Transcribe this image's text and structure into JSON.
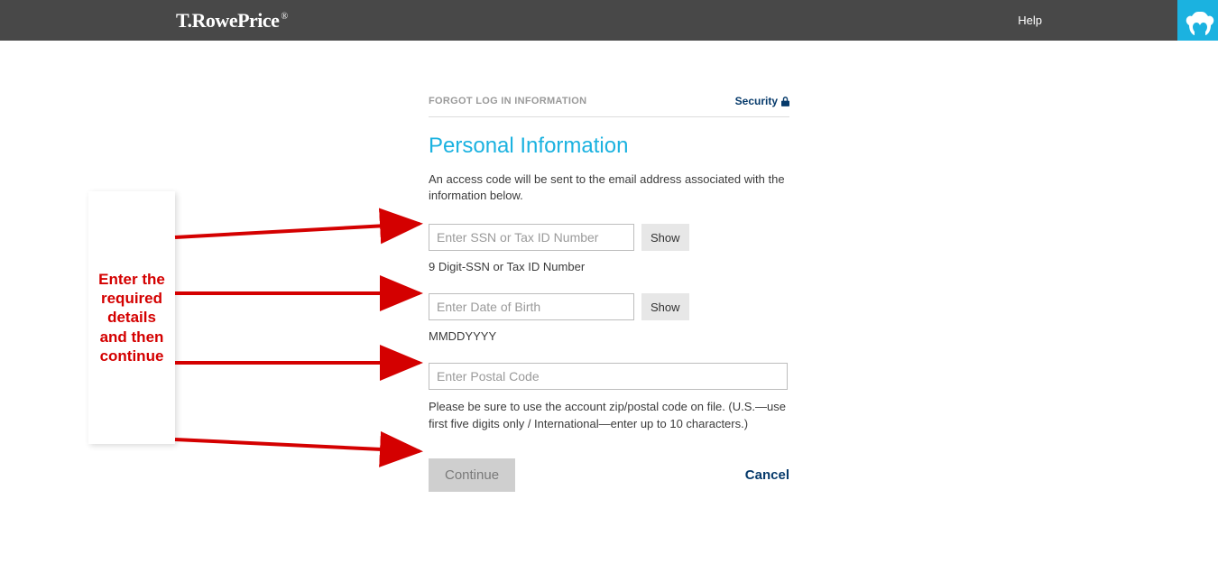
{
  "header": {
    "brand_text": "T.RowePrice",
    "brand_mark": "®",
    "help_label": "Help"
  },
  "page": {
    "forgot_label": "FORGOT LOG IN INFORMATION",
    "security_label": "Security",
    "title": "Personal Information",
    "description": "An access code will be sent to the email address associated with the information below."
  },
  "fields": {
    "ssn": {
      "placeholder": "Enter SSN or Tax ID Number",
      "show_label": "Show",
      "hint": "9 Digit-SSN or Tax ID Number"
    },
    "dob": {
      "placeholder": "Enter Date of Birth",
      "show_label": "Show",
      "hint": "MMDDYYYY"
    },
    "postal": {
      "placeholder": "Enter Postal Code",
      "hint": "Please be sure to use the account zip/postal code on file. (U.S.—use first five digits only / International—enter up to 10 characters.)"
    }
  },
  "actions": {
    "continue_label": "Continue",
    "cancel_label": "Cancel"
  },
  "annotation": {
    "callout_text": "Enter the required details and then continue"
  }
}
